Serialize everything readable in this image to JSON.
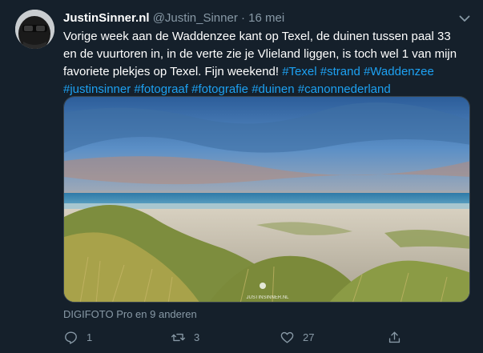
{
  "tweet": {
    "display_name": "JustinSinner.nl",
    "handle": "@Justin_Sinner",
    "separator": "·",
    "date": "16 mei",
    "text_lines": [
      [
        {
          "t": "Vorige week aan de Waddenzee kant op Texel, de duinen tussen paal 33"
        }
      ],
      [
        {
          "t": "en de vuurtoren in, in de verte zie je Vlieland liggen, is toch wel 1 van mijn"
        }
      ],
      [
        {
          "t": "favoriete plekjes op Texel. Fijn weekend! "
        },
        {
          "t": "#Texel",
          "tag": true
        },
        {
          "t": " "
        },
        {
          "t": "#strand",
          "tag": true
        },
        {
          "t": " "
        },
        {
          "t": "#Waddenzee",
          "tag": true
        }
      ],
      [
        {
          "t": "#justinsinner",
          "tag": true
        },
        {
          "t": " "
        },
        {
          "t": "#fotograaf",
          "tag": true
        },
        {
          "t": " "
        },
        {
          "t": "#fotografie",
          "tag": true
        },
        {
          "t": " "
        },
        {
          "t": "#duinen",
          "tag": true
        },
        {
          "t": " "
        },
        {
          "t": "#canonnederland",
          "tag": true
        }
      ]
    ],
    "photo_watermark": "JUSTINSINNER.NL",
    "liked_by": "DIGIFOTO Pro en 9 anderen",
    "actions": {
      "reply": {
        "icon": "reply-icon",
        "count": "1"
      },
      "retweet": {
        "icon": "retweet-icon",
        "count": "3"
      },
      "like": {
        "icon": "heart-icon",
        "count": "27"
      },
      "share": {
        "icon": "share-icon",
        "count": ""
      }
    }
  },
  "colors": {
    "background": "#15202b",
    "secondary_text": "#8899a6",
    "link": "#1da1f2"
  }
}
